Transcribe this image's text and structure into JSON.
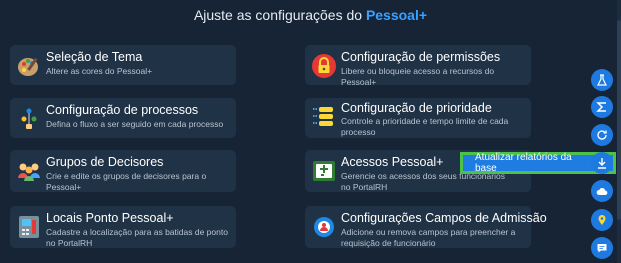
{
  "header": {
    "prefix": "Ajuste as configurações do ",
    "brand": "Pessoal+"
  },
  "cards": [
    {
      "title": "Seleção de Tema",
      "desc": "Altere as cores do Pessoal+",
      "icon": "palette-icon"
    },
    {
      "title": "Configuração de permissões",
      "desc": "Libere ou bloqueie acesso a recursos do Pessoal+",
      "icon": "lock-icon"
    },
    {
      "title": "Configuração de processos",
      "desc": "Defina o fluxo a ser seguido em cada processo",
      "icon": "process-flow-icon"
    },
    {
      "title": "Configuração de prioridade",
      "desc": "Controle a prioridade e tempo limite de cada processo",
      "icon": "priority-stack-icon"
    },
    {
      "title": "Grupos de Decisores",
      "desc": "Crie e edite os grupos de decisores para o Pessoal+",
      "icon": "group-users-icon"
    },
    {
      "title": "Acessos Pessoal+",
      "desc": "Gerencie os acessos dos seus funcionários no PortalRH",
      "icon": "portal-access-icon"
    },
    {
      "title": "Locais Ponto Pessoal+",
      "desc": "Cadastre a localização para as batidas de ponto no PortalRH",
      "icon": "time-clock-icon"
    },
    {
      "title": "Configurações Campos de Admissão",
      "desc": "Adicione ou remova campos para preencher a requisição de funcionário",
      "icon": "admission-gear-icon"
    }
  ],
  "tooltip": {
    "label": "Atualizar relatórios da base"
  },
  "sidebar": {
    "buttons": [
      "flask-icon",
      "sigma-icon",
      "refresh-icon",
      "download-icon",
      "cloud-icon",
      "map-pin-icon",
      "chat-icon"
    ]
  },
  "colors": {
    "background": "#162436",
    "card": "#203246",
    "accent": "#1e7ae0",
    "brand": "#3aa1ff",
    "highlight": "#4cc24a"
  }
}
